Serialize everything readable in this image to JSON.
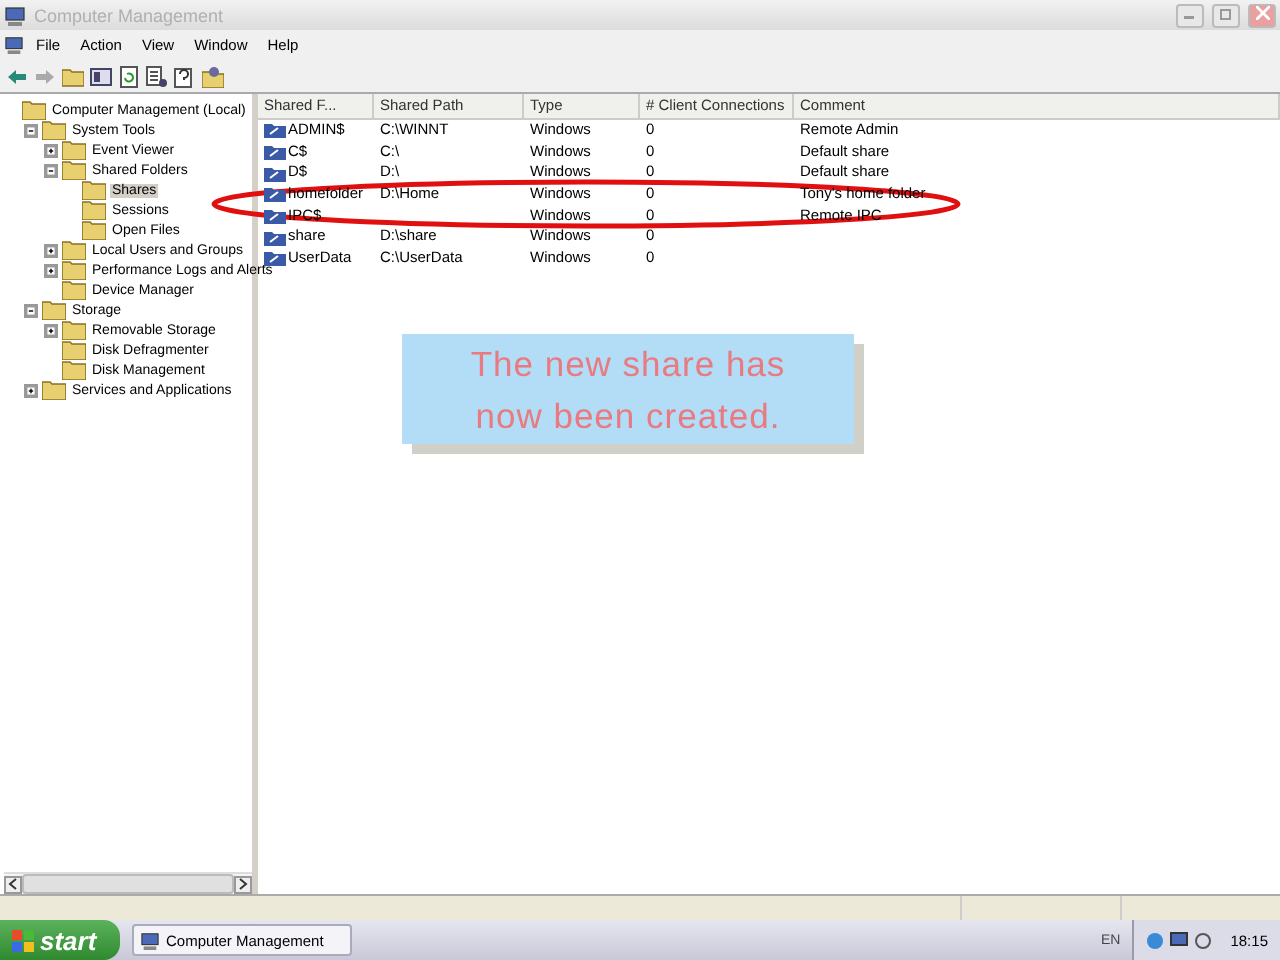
{
  "window": {
    "title": "Computer Management"
  },
  "menu": [
    "File",
    "Action",
    "View",
    "Window",
    "Help"
  ],
  "tree": [
    {
      "label": "Computer Management (Local)",
      "selected": false,
      "children": [
        {
          "label": "System Tools",
          "selected": false,
          "expanded": true,
          "children": [
            {
              "label": "Event Viewer",
              "selected": false,
              "expanded": false
            },
            {
              "label": "Shared Folders",
              "selected": false,
              "expanded": true,
              "children": [
                {
                  "label": "Shares",
                  "selected": true
                },
                {
                  "label": "Sessions",
                  "selected": false
                },
                {
                  "label": "Open Files",
                  "selected": false
                }
              ]
            },
            {
              "label": "Local Users and Groups",
              "selected": false,
              "expanded": false
            },
            {
              "label": "Performance Logs and Alerts",
              "selected": false,
              "expanded": false
            },
            {
              "label": "Device Manager",
              "selected": false
            }
          ]
        },
        {
          "label": "Storage",
          "selected": false,
          "expanded": true,
          "children": [
            {
              "label": "Removable Storage",
              "selected": false,
              "expanded": false
            },
            {
              "label": "Disk Defragmenter",
              "selected": false
            },
            {
              "label": "Disk Management",
              "selected": false
            }
          ]
        },
        {
          "label": "Services and Applications",
          "selected": false,
          "expanded": false
        }
      ]
    }
  ],
  "table": {
    "columns": [
      "Shared F...",
      "Shared Path",
      "Type",
      "# Client Connections",
      "Comment"
    ],
    "rows": [
      [
        "ADMIN$",
        "C:\\WINNT",
        "Windows",
        "0",
        "Remote Admin"
      ],
      [
        "C$",
        "C:\\",
        "Windows",
        "0",
        "Default share"
      ],
      [
        "D$",
        "D:\\",
        "Windows",
        "0",
        "Default share"
      ],
      [
        "homefolder",
        "D:\\Home",
        "Windows",
        "0",
        "Tony's home folder"
      ],
      [
        "IPC$",
        "",
        "Windows",
        "0",
        "Remote IPC"
      ],
      [
        "share",
        "D:\\share",
        "Windows",
        "0",
        ""
      ],
      [
        "UserData",
        "C:\\UserData",
        "Windows",
        "0",
        ""
      ]
    ]
  },
  "callout": {
    "text": "The new share has now been created."
  },
  "taskbar": {
    "start": "start",
    "tasks": [
      "Computer Management"
    ],
    "language": "EN",
    "clock": "18:15"
  }
}
